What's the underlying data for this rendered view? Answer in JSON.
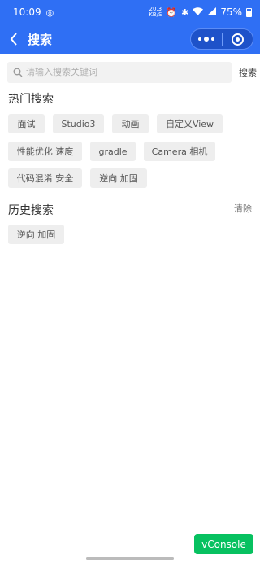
{
  "status_bar": {
    "time": "10:09",
    "battery": "75%"
  },
  "nav": {
    "title": "搜索"
  },
  "search": {
    "placeholder": "请输入搜索关键词",
    "value": "",
    "button_label": "搜索"
  },
  "hot": {
    "title": "热门搜索",
    "tags": [
      "面试",
      "Studio3",
      "动画",
      "自定义View",
      "性能优化 速度",
      "gradle",
      "Camera 相机",
      "代码混淆 安全",
      "逆向 加固"
    ]
  },
  "history": {
    "title": "历史搜索",
    "clear_label": "清除",
    "tags": [
      "逆向 加固"
    ]
  },
  "vconsole_label": "vConsole",
  "colors": {
    "header_blue": "#2f6ff4",
    "vconsole_green": "#07c160",
    "tag_bg": "#eeeeee"
  }
}
